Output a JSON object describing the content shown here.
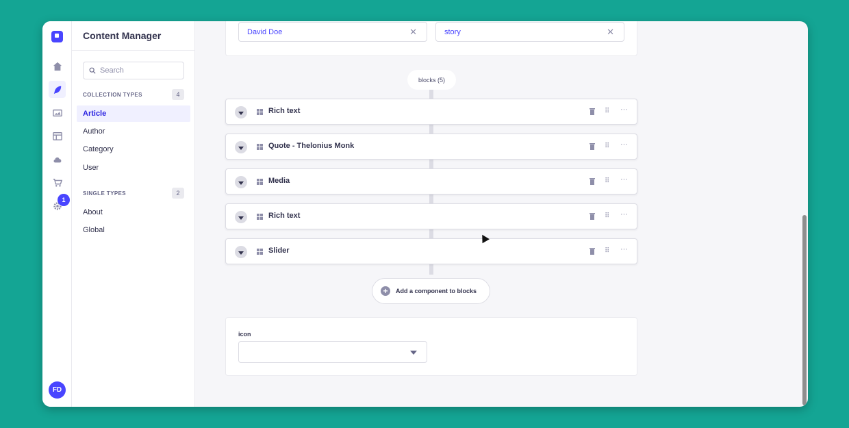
{
  "rail": {
    "icons": [
      "home-icon",
      "feather-icon",
      "image-icon",
      "layout-icon",
      "cloud-icon",
      "cart-icon",
      "gear-icon"
    ],
    "settings_badge": "1",
    "avatar_initials": "FD"
  },
  "subnav": {
    "title": "Content Manager",
    "search_placeholder": "Search",
    "collection_types_label": "COLLECTION TYPES",
    "collection_types_count": "4",
    "collection_items": [
      "Article",
      "Author",
      "Category",
      "User"
    ],
    "single_types_label": "SINGLE TYPES",
    "single_types_count": "2",
    "single_items": [
      "About",
      "Global"
    ]
  },
  "relations": {
    "author": "David Doe",
    "category": "story"
  },
  "blocks": {
    "label": "blocks (5)",
    "items": [
      "Rich text",
      "Quote - Thelonius Monk",
      "Media",
      "Rich text",
      "Slider"
    ],
    "add_label": "Add a component to blocks"
  },
  "icon_field": {
    "label": "icon",
    "value": ""
  },
  "colors": {
    "primary": "#4945ff",
    "background": "#14a594"
  }
}
